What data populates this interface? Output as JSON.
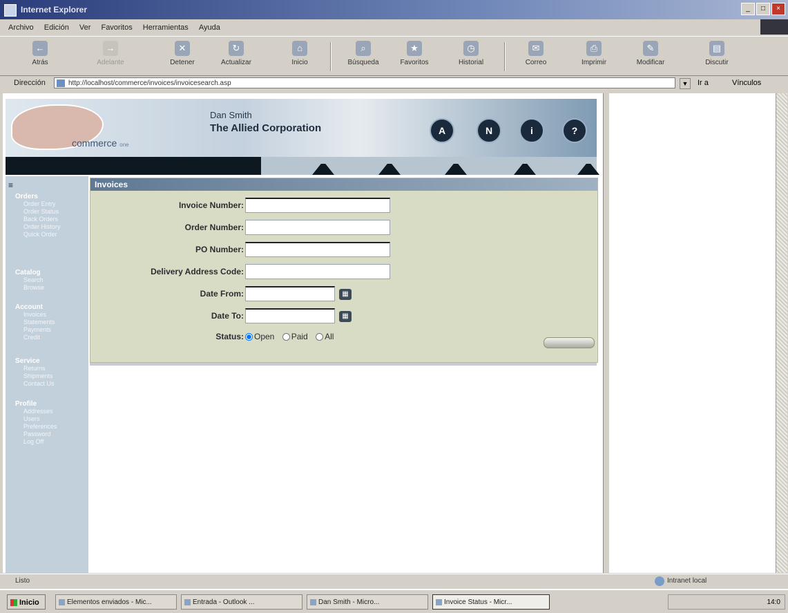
{
  "window": {
    "title": "Internet Explorer"
  },
  "menu": [
    "Archivo",
    "Edición",
    "Ver",
    "Favoritos",
    "Herramientas",
    "Ayuda"
  ],
  "toolbar": [
    "Atrás",
    "Adelante",
    "Detener",
    "Actualizar",
    "Inicio",
    "Búsqueda",
    "Favoritos",
    "Historial",
    "Correo",
    "Imprimir",
    "Modificar",
    "Discutir"
  ],
  "address": {
    "label": "Dirección",
    "url": "http://localhost/commerce/invoices/invoicesearch.asp",
    "go": "Ir a",
    "links": "Vínculos"
  },
  "header": {
    "brand": "commerce",
    "brand_sub": "one",
    "user_name": "Dan Smith",
    "company": "The Allied Corporation",
    "icons": [
      "A",
      "N",
      "i",
      "?"
    ]
  },
  "sidebar": {
    "menu_icon": "≡",
    "groups": [
      {
        "title": "Orders",
        "items": [
          "Order Entry",
          "Order Status",
          "Back Orders",
          "Order History",
          "Quick Order"
        ]
      },
      {
        "title": "Catalog",
        "items": [
          "Search",
          "Browse"
        ]
      },
      {
        "title": "Account",
        "items": [
          "Invoices",
          "Statements",
          "Payments",
          "Credit"
        ]
      },
      {
        "title": "Service",
        "items": [
          "Returns",
          "Shipments",
          "Contact Us"
        ]
      },
      {
        "title": "Profile",
        "items": [
          "Addresses",
          "Users",
          "Preferences",
          "Password",
          "Log Off"
        ]
      }
    ]
  },
  "panel": {
    "title": "Invoices",
    "fields": {
      "invoice_number": "Invoice Number:",
      "order_number": "Order Number:",
      "po_number": "PO Number:",
      "delivery_code": "Delivery Address Code:",
      "date_from": "Date From:",
      "date_to": "Date To:",
      "status": "Status:"
    },
    "status_options": [
      "Open",
      "Paid",
      "All"
    ],
    "status_selected": "Open"
  },
  "statusbar": {
    "left": "Listo",
    "zone": "Intranet local"
  },
  "taskbar": {
    "start": "Inicio",
    "tasks": [
      "Elementos enviados - Mic...",
      "Entrada - Outlook ...",
      "Dan Smith - Micro...",
      "Invoice Status - Micr..."
    ],
    "clock": "14:0"
  }
}
